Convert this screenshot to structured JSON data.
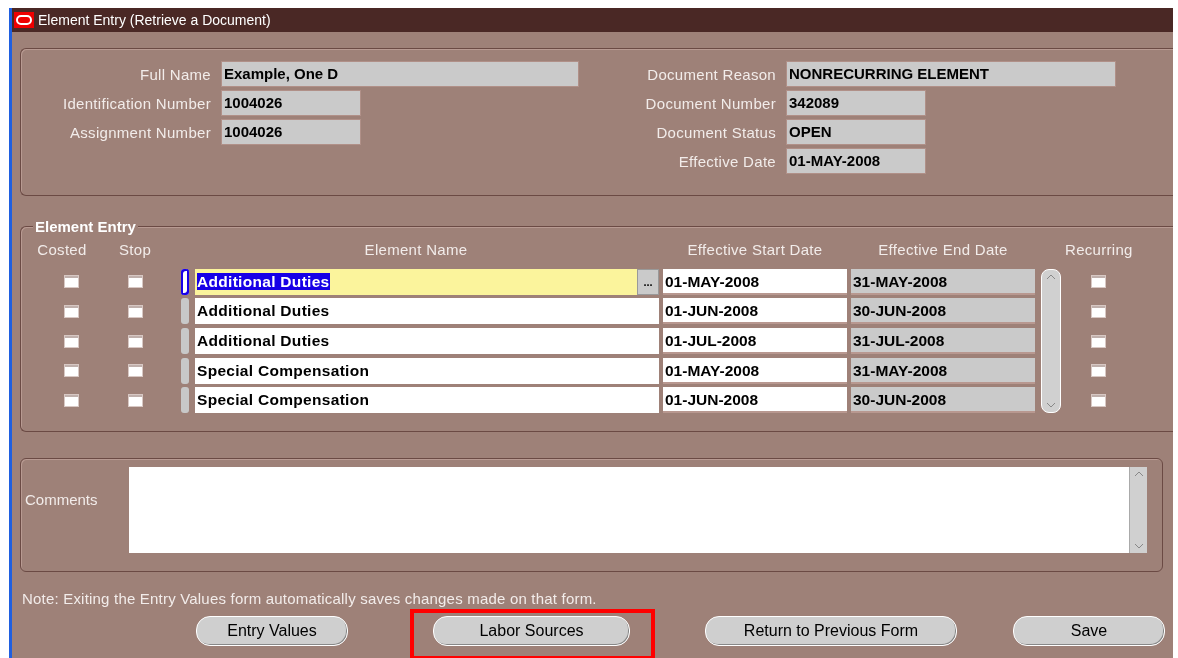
{
  "window": {
    "title": "Element Entry (Retrieve a Document)"
  },
  "header": {
    "left": [
      {
        "label": "Full Name",
        "value": "Example, One D"
      },
      {
        "label": "Identification Number",
        "value": "1004026"
      },
      {
        "label": "Assignment Number",
        "value": "1004026"
      }
    ],
    "right": [
      {
        "label": "Document Reason",
        "value": "NONRECURRING ELEMENT"
      },
      {
        "label": "Document Number",
        "value": "342089"
      },
      {
        "label": "Document Status",
        "value": "OPEN"
      },
      {
        "label": "Effective Date",
        "value": "01-MAY-2008"
      }
    ]
  },
  "element_entry": {
    "title": "Element Entry",
    "columns": [
      "Costed",
      "Stop",
      "Element Name",
      "Effective Start Date",
      "Effective End Date",
      "Recurring"
    ],
    "lov_button": "...",
    "rows": [
      {
        "costed": false,
        "stop": false,
        "selected": true,
        "element_name": "Additional Duties",
        "start_date": "01-MAY-2008",
        "end_date": "31-MAY-2008",
        "recurring": false
      },
      {
        "costed": false,
        "stop": false,
        "selected": false,
        "element_name": "Additional Duties",
        "start_date": "01-JUN-2008",
        "end_date": "30-JUN-2008",
        "recurring": false
      },
      {
        "costed": false,
        "stop": false,
        "selected": false,
        "element_name": "Additional Duties",
        "start_date": "01-JUL-2008",
        "end_date": "31-JUL-2008",
        "recurring": false
      },
      {
        "costed": false,
        "stop": false,
        "selected": false,
        "element_name": "Special Compensation",
        "start_date": "01-MAY-2008",
        "end_date": "31-MAY-2008",
        "recurring": false
      },
      {
        "costed": false,
        "stop": false,
        "selected": false,
        "element_name": "Special Compensation",
        "start_date": "01-JUN-2008",
        "end_date": "30-JUN-2008",
        "recurring": false
      }
    ]
  },
  "comments": {
    "label": "Comments"
  },
  "note": "Note: Exiting the Entry Values form automatically saves changes made on that form.",
  "buttons": [
    {
      "label": "Entry Values",
      "highlighted": false
    },
    {
      "label": "Labor Sources",
      "highlighted": true
    },
    {
      "label": "Return to Previous Form",
      "highlighted": false
    },
    {
      "label": "Save",
      "highlighted": false
    }
  ]
}
